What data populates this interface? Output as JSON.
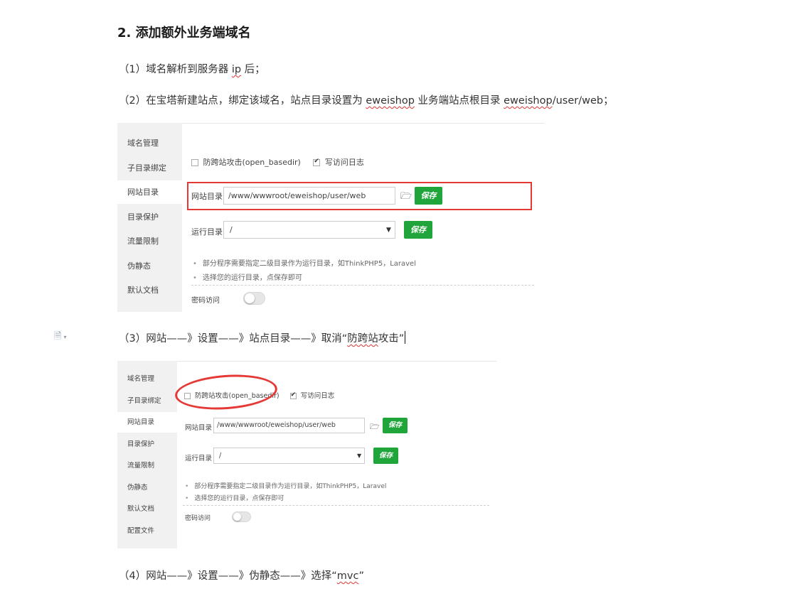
{
  "doc": {
    "heading": "2. 添加额外业务端域名",
    "p1": "（1）域名解析到服务器 ",
    "p1_ip": "ip",
    "p1_tail": " 后；",
    "p2_a": "（2）在宝塔新建站点，绑定该域名，站点目录设置为 ",
    "p2_b": "eweishop",
    "p2_c": " 业务端站点根目录 ",
    "p2_d": "eweishop",
    "p2_e": "/user/web；",
    "p3_a": "（3）网站——》设置——》站点目录——》取消“",
    "p3_b": "防跨站",
    "p3_c": "攻击”",
    "p4_a": "（4）网站——》设置——》伪静态——》选择“",
    "p4_b": "mvc",
    "p4_c": "”",
    "margin_icon": "document-icon"
  },
  "panel1": {
    "sidebar": [
      "域名管理",
      "子目录绑定",
      "网站目录",
      "目录保护",
      "流量限制",
      "伪静态",
      "默认文档"
    ],
    "active_index": 2,
    "anti_xss_label": "防跨站攻击(open_basedir)",
    "anti_xss_checked": false,
    "log_label": "写访问日志",
    "log_checked": true,
    "site_dir_label": "网站目录",
    "site_dir_value": "/www/wwwroot/eweishop/user/web",
    "save": "保存",
    "run_dir_label": "运行目录",
    "run_dir_value": "/",
    "hint1": "部分程序需要指定二级目录作为运行目录，如ThinkPHP5，Laravel",
    "hint2": "选择您的运行目录，点保存即可",
    "password_label": "密码访问"
  },
  "panel2": {
    "sidebar": [
      "域名管理",
      "子目录绑定",
      "网站目录",
      "目录保护",
      "流量限制",
      "伪静态",
      "默认文档",
      "配置文件"
    ],
    "active_index": 2,
    "anti_xss_label": "防跨站攻击(open_basedir)",
    "anti_xss_checked": false,
    "log_label": "写访问日志",
    "log_checked": true,
    "site_dir_label": "网站目录",
    "site_dir_value": "/www/wwwroot/eweishop/user/web",
    "save": "保存",
    "run_dir_label": "运行目录",
    "run_dir_value": "/",
    "hint1": "部分程序需要指定二级目录作为运行目录，如ThinkPHP5，Laravel",
    "hint2": "选择您的运行目录，点保存即可",
    "password_label": "密码访问"
  },
  "colors": {
    "accent_green": "#20a53a",
    "highlight_red": "#e53935",
    "sidebar_bg": "#f1f1f1"
  }
}
